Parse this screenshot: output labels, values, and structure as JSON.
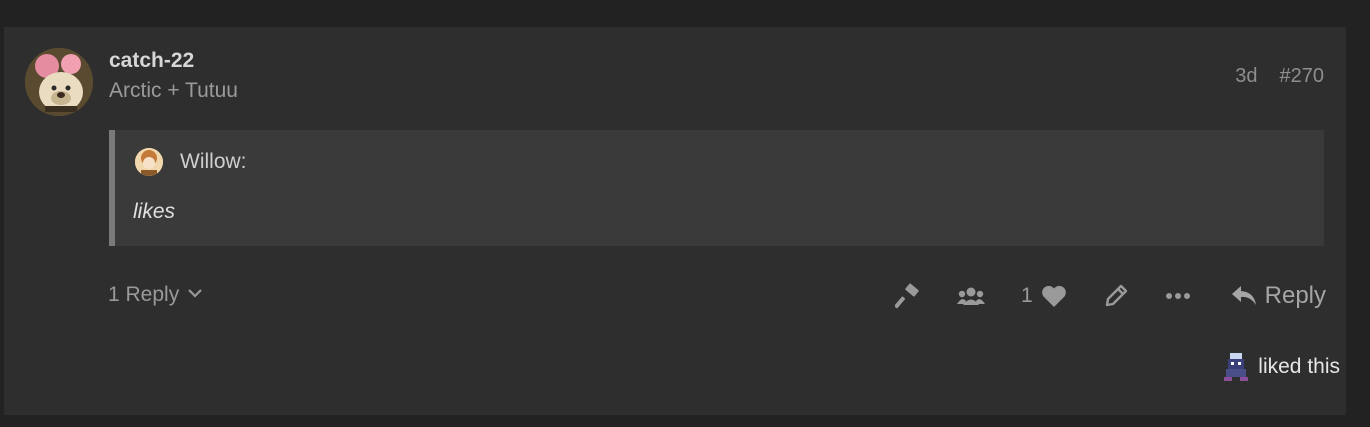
{
  "post": {
    "username": "catch-22",
    "user_title": "Arctic + Tutuu",
    "age": "3d",
    "number": "#270"
  },
  "quote": {
    "author": "Willow:",
    "text": "likes"
  },
  "footer": {
    "replies_label": "1 Reply",
    "like_count": "1",
    "reply_label": "Reply",
    "liked_text": "liked this"
  },
  "icons": {
    "admin": "hammer-icon",
    "group": "users-icon",
    "like": "heart-icon",
    "edit": "pencil-icon",
    "more": "ellipsis-icon",
    "reply": "reply-icon",
    "expand": "chevron-down-icon"
  },
  "colors": {
    "page_bg": "#222222",
    "post_bg": "#2e2e2e",
    "quote_bg": "#3a3a3a",
    "quote_border": "#7a7a7a"
  }
}
